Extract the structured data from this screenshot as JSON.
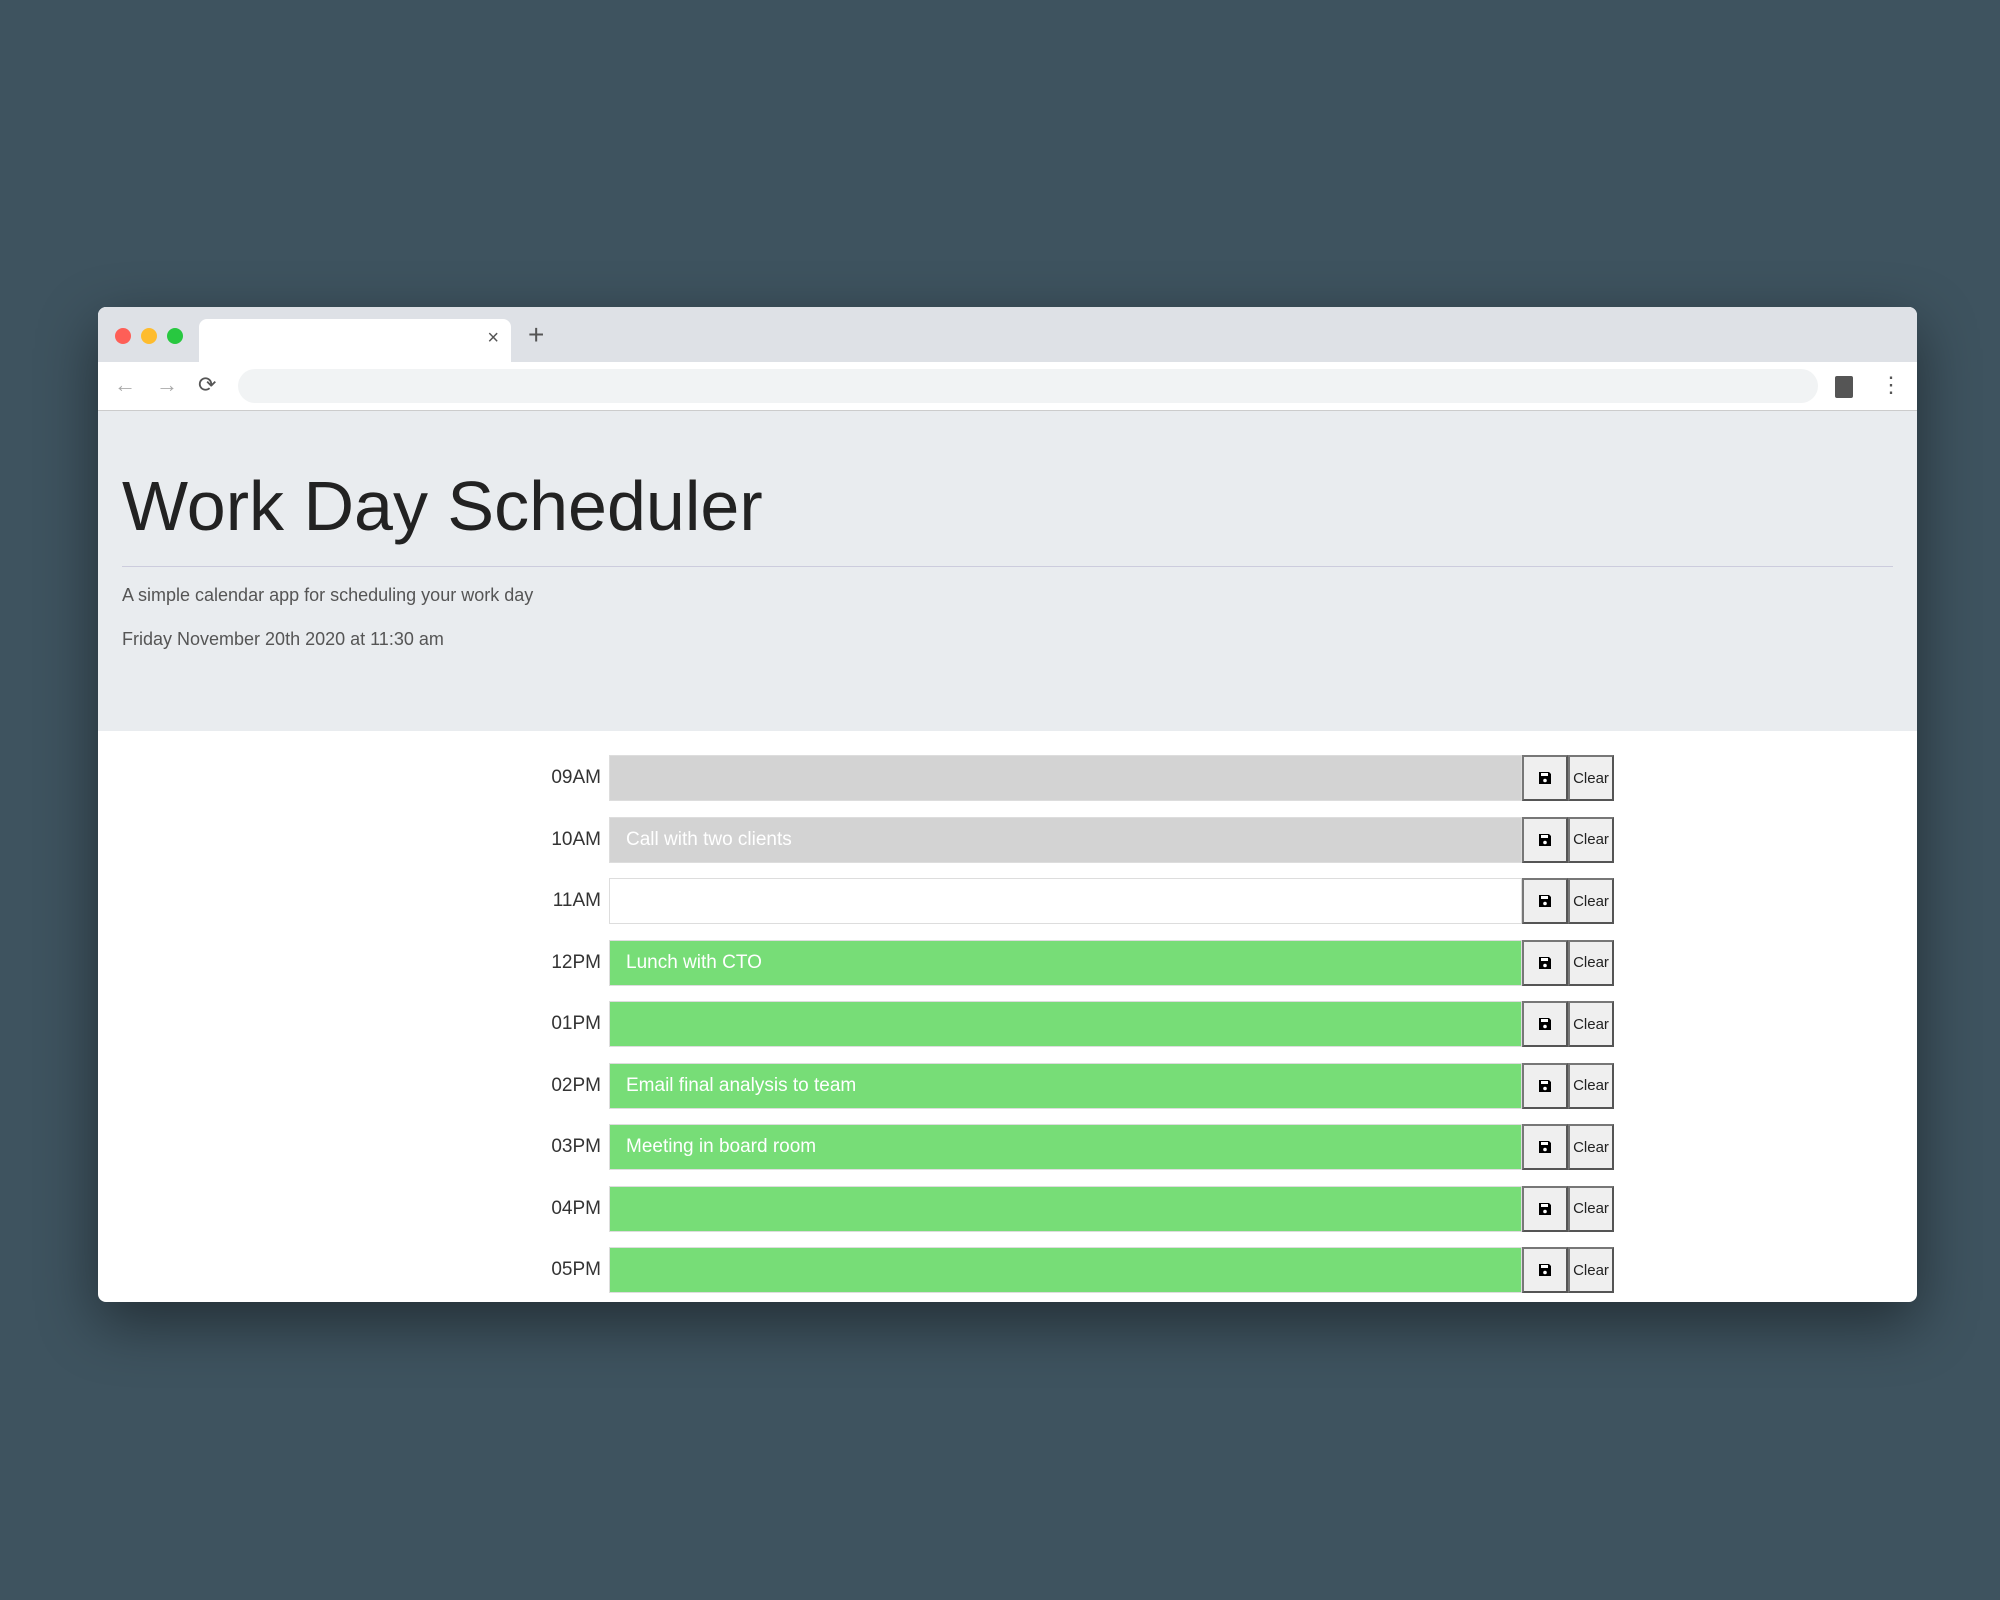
{
  "browser": {
    "tab_close": "×",
    "new_tab": "+",
    "back": "←",
    "forward": "→",
    "reload": "⟳",
    "menu": "⋮"
  },
  "header": {
    "title": "Work Day Scheduler",
    "subtitle": "A simple calendar app for scheduling your work day",
    "current_date": "Friday November 20th 2020 at 11:30 am"
  },
  "colors": {
    "past": "#d3d3d3",
    "present": "#ffffff",
    "future": "#77dd77"
  },
  "rows": [
    {
      "hour": "09AM",
      "task": "",
      "state": "past"
    },
    {
      "hour": "10AM",
      "task": "Call with two clients",
      "state": "past"
    },
    {
      "hour": "11AM",
      "task": "",
      "state": "present"
    },
    {
      "hour": "12PM",
      "task": "Lunch with CTO",
      "state": "future"
    },
    {
      "hour": "01PM",
      "task": "",
      "state": "future"
    },
    {
      "hour": "02PM",
      "task": "Email final analysis to team",
      "state": "future"
    },
    {
      "hour": "03PM",
      "task": "Meeting in board room",
      "state": "future"
    },
    {
      "hour": "04PM",
      "task": "",
      "state": "future"
    },
    {
      "hour": "05PM",
      "task": "",
      "state": "future"
    }
  ],
  "buttons": {
    "save_icon": "floppy-disk-icon",
    "clear_label": "Clear"
  }
}
